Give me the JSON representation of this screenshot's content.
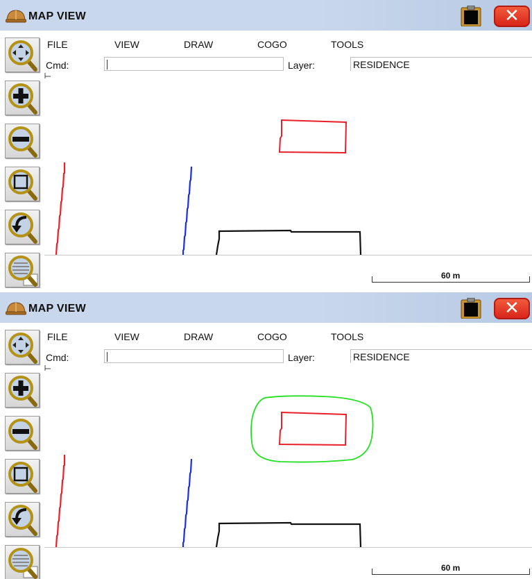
{
  "panels": [
    {
      "title": "MAP VIEW",
      "menu": [
        "FILE",
        "VIEW",
        "DRAW",
        "COGO",
        "TOOLS"
      ],
      "cmd_label": "Cmd:",
      "cmd_value": "",
      "layer_label": "Layer:",
      "layer_value": "RESIDENCE",
      "scale_label": "60 m",
      "map": {
        "show_buffer": false
      }
    },
    {
      "title": "MAP VIEW",
      "menu": [
        "FILE",
        "VIEW",
        "DRAW",
        "COGO",
        "TOOLS"
      ],
      "cmd_label": "Cmd:",
      "cmd_value": "",
      "layer_label": "Layer:",
      "layer_value": "RESIDENCE",
      "scale_label": "60 m",
      "map": {
        "show_buffer": true
      }
    }
  ],
  "icons": {
    "app": "hard-hat-icon",
    "clipboard": "clipboard-icon",
    "close": "close-icon",
    "tools": [
      "zoom-pan-icon",
      "zoom-in-icon",
      "zoom-out-icon",
      "zoom-window-icon",
      "zoom-previous-icon",
      "zoom-list-icon"
    ]
  },
  "colors": {
    "titlebar": "#c9d7ec",
    "close": "#e03a22",
    "line_red": "#e8202a",
    "line_blue": "#1a2de0",
    "line_black": "#111111",
    "buffer_green": "#22e022"
  }
}
